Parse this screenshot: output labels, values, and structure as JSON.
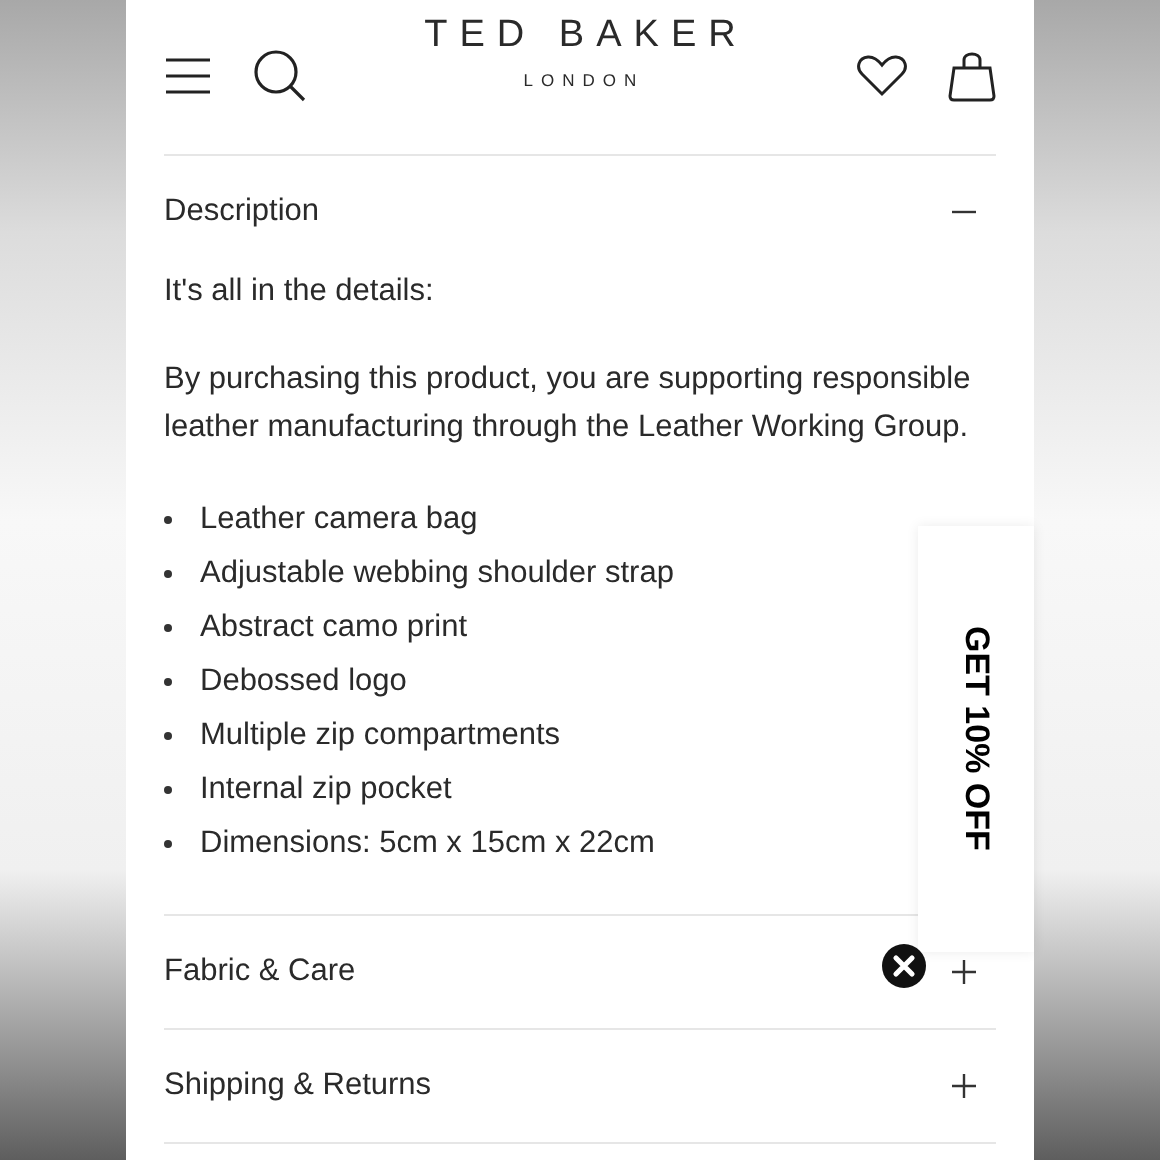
{
  "header": {
    "brand": "TED BAKER",
    "brand_sub": "LONDON"
  },
  "sections": [
    {
      "title": "Description",
      "expanded": true,
      "intro": "It's all in the details:",
      "paragraph": "By purchasing this product, you are supporting responsible leather manufacturing through the Leather Working Group.",
      "bullets": [
        "Leather camera bag",
        "Adjustable webbing shoulder strap",
        "Abstract camo print",
        "Debossed logo",
        "Multiple zip compartments",
        "Internal zip pocket",
        "Dimensions: 5cm x 15cm x 22cm"
      ]
    },
    {
      "title": "Fabric & Care",
      "expanded": false
    },
    {
      "title": "Shipping & Returns",
      "expanded": false
    }
  ],
  "promo_tab": {
    "label": "GET 10% OFF"
  }
}
